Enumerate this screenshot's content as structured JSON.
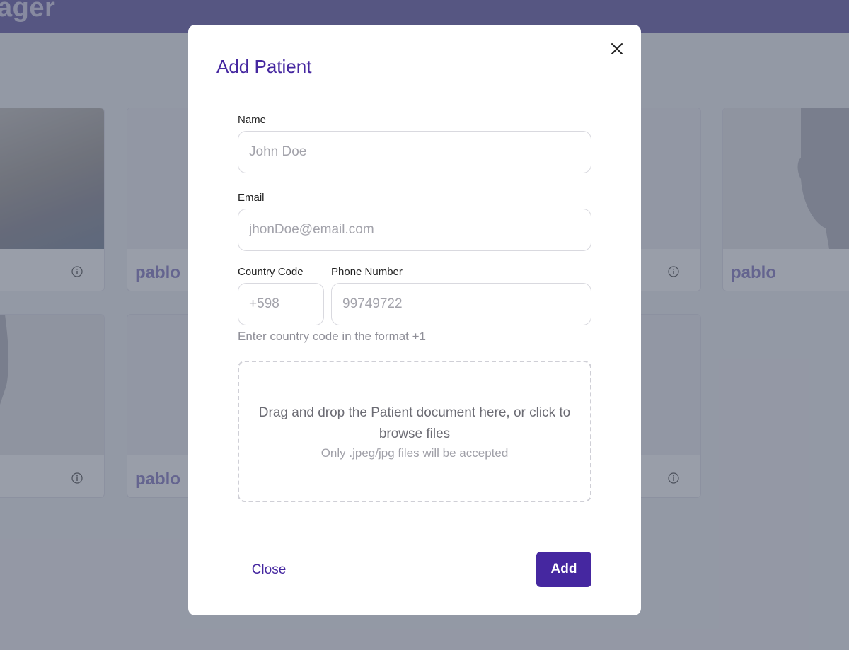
{
  "app": {
    "title": "ager"
  },
  "background_cards": [
    {
      "name": ""
    },
    {
      "name": "pablo"
    },
    {
      "name": ""
    },
    {
      "name": "pablo"
    },
    {
      "name": ""
    },
    {
      "name": "pablo"
    },
    {
      "name": ""
    }
  ],
  "modal": {
    "title": "Add Patient",
    "name_label": "Name",
    "name_placeholder": "John Doe",
    "email_label": "Email",
    "email_placeholder": "jhonDoe@email.com",
    "country_code_label": "Country Code",
    "country_code_placeholder": "+598",
    "phone_label": "Phone Number",
    "phone_placeholder": "99749722",
    "country_code_helper": "Enter country code in the format +1",
    "dropzone_text": "Drag and drop the Patient document here, or click to browse files",
    "dropzone_subtext": "Only .jpeg/jpg files will be accepted",
    "close_label": "Close",
    "add_label": "Add"
  },
  "colors": {
    "accent": "#4527a0",
    "header": "#6b5fa8",
    "overlay": "rgba(70,78,98,0.55)"
  }
}
